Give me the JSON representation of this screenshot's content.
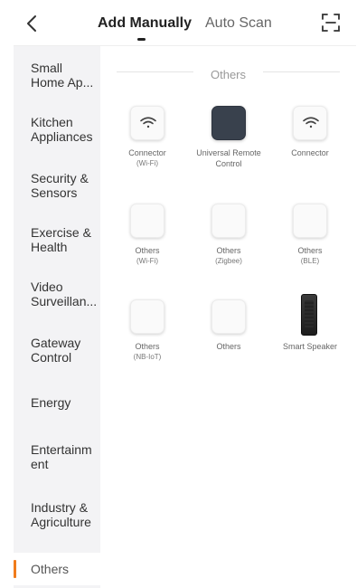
{
  "header": {
    "tabs": [
      "Add Manually",
      "Auto Scan"
    ],
    "active_tab": "Add Manually"
  },
  "sidebar": {
    "items": [
      {
        "label": "Small Home Ap..."
      },
      {
        "label": "Kitchen Appliances"
      },
      {
        "label": "Security & Sensors"
      },
      {
        "label": "Exercise & Health"
      },
      {
        "label": "Video Surveillan..."
      },
      {
        "label": "Gateway Control"
      },
      {
        "label": "Energy"
      },
      {
        "label": "Entertainm ent"
      },
      {
        "label": "Industry & Agriculture"
      },
      {
        "label": "Others"
      }
    ],
    "active": "Others",
    "accent_color": "#f07c1c"
  },
  "main": {
    "section_title": "Others",
    "devices": [
      {
        "label": "Connector",
        "sub": "(Wi-Fi)",
        "icon": "wifi-icon"
      },
      {
        "label": "Universal Remote Control",
        "sub": "",
        "icon": "remote-control-icon"
      },
      {
        "label": "Connector",
        "sub": "",
        "icon": "wifi-icon"
      },
      {
        "label": "Others",
        "sub": "(Wi-Fi)",
        "icon": "device-icon"
      },
      {
        "label": "Others",
        "sub": "(Zigbee)",
        "icon": "device-icon"
      },
      {
        "label": "Others",
        "sub": "(BLE)",
        "icon": "device-icon"
      },
      {
        "label": "Others",
        "sub": "(NB-IoT)",
        "icon": "device-icon"
      },
      {
        "label": "Others",
        "sub": "",
        "icon": "device-icon"
      },
      {
        "label": "Smart Speaker",
        "sub": "",
        "icon": "smart-speaker-icon"
      }
    ]
  }
}
